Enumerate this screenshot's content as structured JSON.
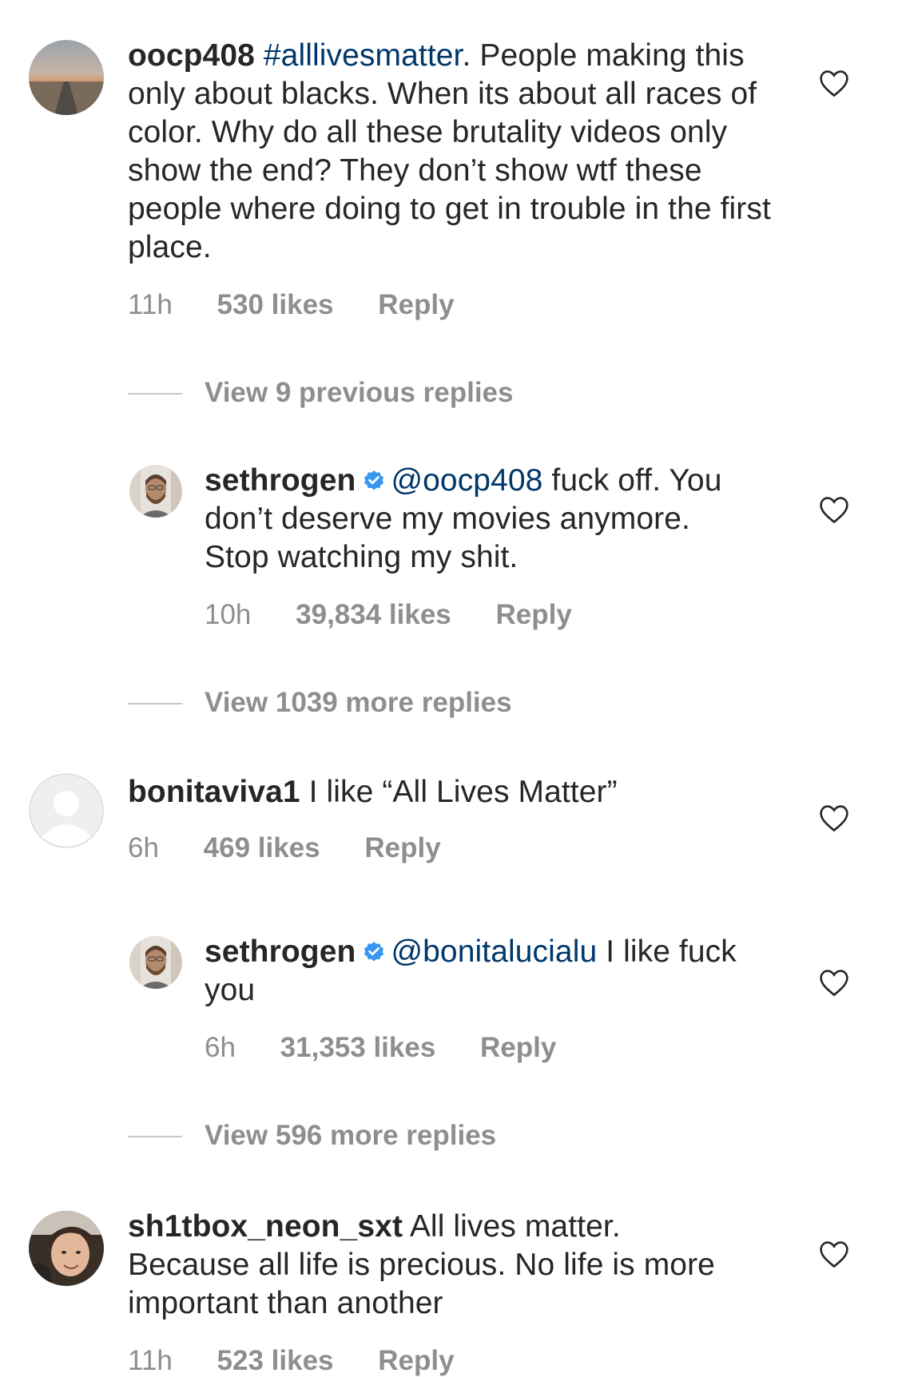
{
  "colors": {
    "text": "#262626",
    "secondary": "#8e8e8e",
    "mention": "#00376b",
    "verified_badge": "#3897f0"
  },
  "comments": [
    {
      "username": "oocp408",
      "mention": "#alllivesmatter",
      "text_after_mention": ".  People making this only about blacks. When its about all races of color. Why do all these brutality videos only show the end? They don’t show wtf these people where doing to get in trouble in the first place.",
      "time": "11h",
      "likes": "530 likes",
      "reply": "Reply",
      "avatar_icon": "landscape-avatar",
      "like_icon": "heart-icon"
    },
    {
      "view_replies": "View 9 previous replies"
    },
    {
      "username": "sethrogen",
      "verified": true,
      "mention": "@oocp408",
      "text_after_mention": " fuck off. You don’t deserve my movies anymore. Stop watching my shit.",
      "time": "10h",
      "likes": "39,834 likes",
      "reply": "Reply",
      "avatar_icon": "person-avatar",
      "like_icon": "heart-icon"
    },
    {
      "view_replies": "View 1039 more replies"
    },
    {
      "username": "bonitaviva1",
      "text": " I like “All Lives Matter”",
      "time": "6h",
      "likes": "469 likes",
      "reply": "Reply",
      "avatar_icon": "default-avatar",
      "like_icon": "heart-icon"
    },
    {
      "username": "sethrogen",
      "verified": true,
      "mention": "@bonitalucialu",
      "text_after_mention": " I like fuck you",
      "time": "6h",
      "likes": "31,353 likes",
      "reply": "Reply",
      "avatar_icon": "person-avatar",
      "like_icon": "heart-icon"
    },
    {
      "view_replies": "View 596 more replies"
    },
    {
      "username": "sh1tbox_neon_sxt",
      "text": " All lives matter. Because all life is precious. No life is more important than another",
      "time": "11h",
      "likes": "523 likes",
      "reply": "Reply",
      "avatar_icon": "person-avatar",
      "like_icon": "heart-icon"
    }
  ]
}
